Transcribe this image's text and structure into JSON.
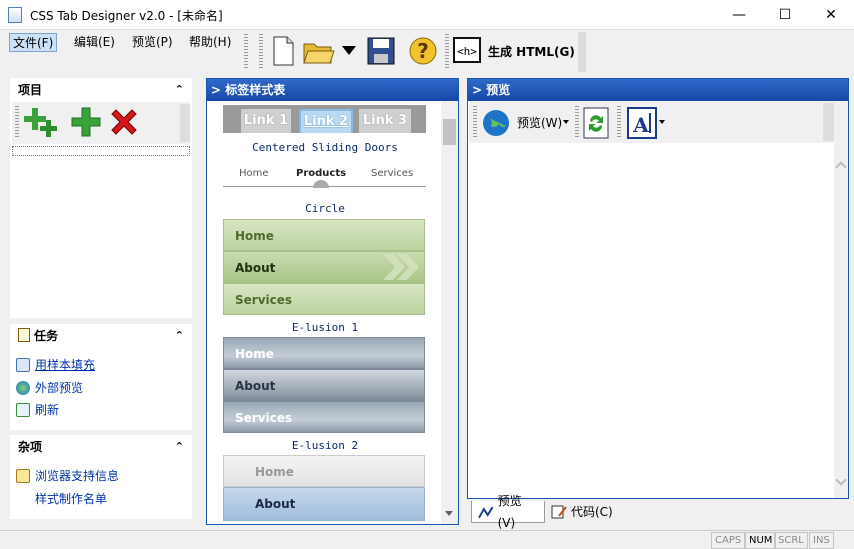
{
  "window": {
    "title": "CSS Tab Designer v2.0 - [未命名]",
    "min_glyph": "—",
    "max_glyph": "☐",
    "close_glyph": "✕"
  },
  "menu": {
    "file": "文件(F)",
    "edit": "编辑(E)",
    "preview": "预览(P)",
    "help": "帮助(H)"
  },
  "toolbar": {
    "generate_label": "生成 HTML(G)"
  },
  "left": {
    "items_title": "项目",
    "tasks_title": "任务",
    "tasks": [
      "用样本填充",
      "外部预览",
      "刷新"
    ],
    "misc_title": "杂项",
    "misc": [
      "浏览器支持信息",
      "样式制作名单"
    ],
    "chevron": "⌃"
  },
  "middle": {
    "title": "> 标签样式表",
    "tabs": [
      "Link 1",
      "Link 2",
      "Link 3"
    ],
    "sample1_caption": "Centered Sliding Doors",
    "sample1_links": [
      "Home",
      "Products",
      "Services"
    ],
    "sample2_caption": "Circle",
    "sample3_caption": "E-lusion 1",
    "sample4_caption": "E-lusion 2",
    "rows": [
      "Home",
      "About",
      "Services"
    ]
  },
  "right": {
    "title": "> 预览",
    "preview_btn": "预览(W)",
    "tab_preview": "预览(V)",
    "tab_code": "代码(C)"
  },
  "status": {
    "caps": "CAPS",
    "num": "NUM",
    "scrl": "SCRL",
    "ins": "INS"
  }
}
